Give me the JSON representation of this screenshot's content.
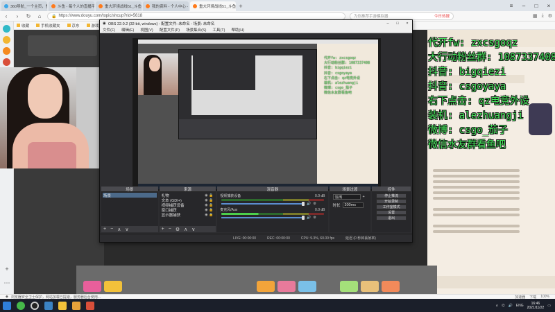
{
  "browser": {
    "tabs": [
      {
        "label": "360导航_一个主页，整个世界",
        "favicon_color": "#3ca7e8",
        "active": false
      },
      {
        "label": "斗鱼 - 每个人的直播平台",
        "favicon_color": "#ff7a1a",
        "active": false
      },
      {
        "label": "重大环境战线51_斗鱼直播平",
        "favicon_color": "#ff7a1a",
        "active": false
      },
      {
        "label": "我的资料 - 个人中心 - 斗鱼",
        "favicon_color": "#ff7a1a",
        "active": false
      },
      {
        "label": "重大环境战线51_斗鱼直播平台",
        "favicon_color": "#ff7a1a",
        "active": true
      }
    ],
    "url": "https://www.douyu.com/topic/shcup?rid=5618",
    "search_placeholder": "为你推荐手游模拟器",
    "search_hot": "今日热搜",
    "bookmarks": [
      "收藏",
      "手机收藏夹",
      "京东",
      "游戏大厅"
    ],
    "status_left": "浏览器安全卫士保护，网站加载已提速，服务器后台使用...",
    "status_right": [
      "加速器",
      "下载",
      "100%"
    ]
  },
  "obs": {
    "title": "OBS 22.0.2 (32-bit, windows) - 配置文件: 未命名 - 场景: 未命名",
    "menu": [
      "文件(F)",
      "编辑(E)",
      "视图(V)",
      "配置文件(P)",
      "场景集合(S)",
      "工具(T)",
      "帮助(H)"
    ],
    "panels": {
      "scenes": {
        "header": "场景",
        "items": [
          "场景"
        ]
      },
      "sources": {
        "header": "来源",
        "items": [
          "礼物",
          "文本 (GDI+)",
          "视频捕获设备",
          "窗口捕获",
          "显示器捕获"
        ]
      },
      "mixer": {
        "header": "混音器",
        "channels": [
          {
            "name": "视频捕获设备",
            "db": "0.0 dB"
          },
          {
            "name": "麦克风/Aux",
            "db": "0.0 dB"
          }
        ]
      },
      "transitions": {
        "header": "场景过渡",
        "type": "淡出",
        "duration_label": "时长",
        "duration": "300ms"
      },
      "controls": {
        "header": "控件",
        "buttons": [
          "停止推流",
          "开始录制",
          "工作室模式",
          "设置",
          "退出"
        ]
      }
    },
    "status": [
      "LIVE: 00:00:00",
      "REC: 00:00:00",
      "CPU: 9.3%, 60.00 fps",
      "延迟 (0 秒钟丢帧率)"
    ]
  },
  "overlay_text": {
    "lines": [
      "代开fw: zxcsgoqz",
      "大行动粉丝群: 1087337408",
      "抖音: bigqiezi",
      "抖音: csgoyaya",
      "右下点击: qz电竞外设",
      "装机: alezhuangji",
      "微博: csgo_茄子",
      "微信水友群看鱼吧"
    ],
    "color": "#44e25a"
  },
  "preview_text": {
    "lines": [
      "代开fw: zxcsgoqz",
      "大行动粉丝群: 1087337408",
      "抖音: bigqiezi",
      "抖音: csgoyaya",
      "右下点击: qz电竞外设",
      "装机: alezhuangji",
      "微博: csgo_茄子",
      "微信水友群看鱼吧"
    ]
  },
  "taskbar": {
    "lang": "ENG",
    "time": "16:46",
    "date": "2021/11/22"
  }
}
